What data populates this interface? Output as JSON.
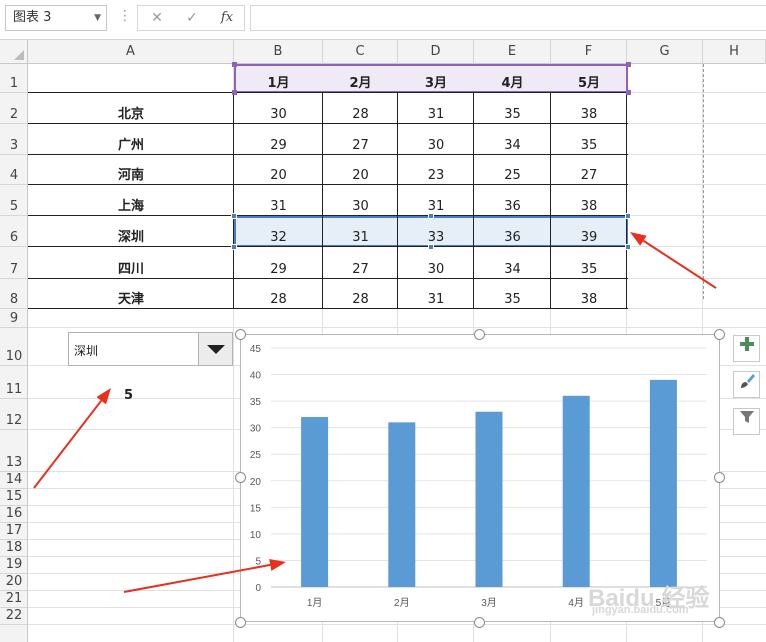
{
  "formula_bar": {
    "name_box": "图表 3",
    "formula_value": "",
    "buttons": {
      "cancel": "✕",
      "enter": "✓",
      "fx": "fx"
    }
  },
  "columns": [
    "A",
    "B",
    "C",
    "D",
    "E",
    "F",
    "G",
    "H"
  ],
  "rows": [
    "1",
    "2",
    "3",
    "4",
    "5",
    "6",
    "7",
    "8",
    "9",
    "10",
    "11",
    "12",
    "13",
    "14",
    "15",
    "16",
    "17",
    "18",
    "19",
    "20",
    "21",
    "22"
  ],
  "table": {
    "headers": [
      "1月",
      "2月",
      "3月",
      "4月",
      "5月"
    ],
    "cities": [
      "北京",
      "广州",
      "河南",
      "上海",
      "深圳",
      "四川",
      "天津"
    ],
    "values": [
      [
        "30",
        "28",
        "31",
        "35",
        "38"
      ],
      [
        "29",
        "27",
        "30",
        "34",
        "35"
      ],
      [
        "20",
        "20",
        "23",
        "25",
        "27"
      ],
      [
        "31",
        "30",
        "31",
        "36",
        "38"
      ],
      [
        "32",
        "31",
        "33",
        "36",
        "39"
      ],
      [
        "29",
        "27",
        "30",
        "34",
        "35"
      ],
      [
        "28",
        "28",
        "31",
        "35",
        "38"
      ]
    ]
  },
  "combo": {
    "selected": "深圳"
  },
  "linked_cell": "5",
  "colors": {
    "bar": "#5b9bd5",
    "arrow": "#e8301f",
    "header_border": "#8c63b5",
    "selection": "#4a7cc9"
  },
  "chart_data": {
    "type": "bar",
    "categories": [
      "1月",
      "2月",
      "3月",
      "4月",
      "5月"
    ],
    "values": [
      32,
      31,
      33,
      36,
      39
    ],
    "ylim": [
      0,
      45
    ],
    "yticks": [
      0,
      5,
      10,
      15,
      20,
      25,
      30,
      35,
      40,
      45
    ],
    "grid": true,
    "legend": "none"
  },
  "chart_tools": {
    "add": "plus-icon",
    "style": "brush-icon",
    "filter": "filter-icon"
  },
  "watermark": {
    "text": "Baidu 经验",
    "sub": "jingyan.baidu.com"
  }
}
